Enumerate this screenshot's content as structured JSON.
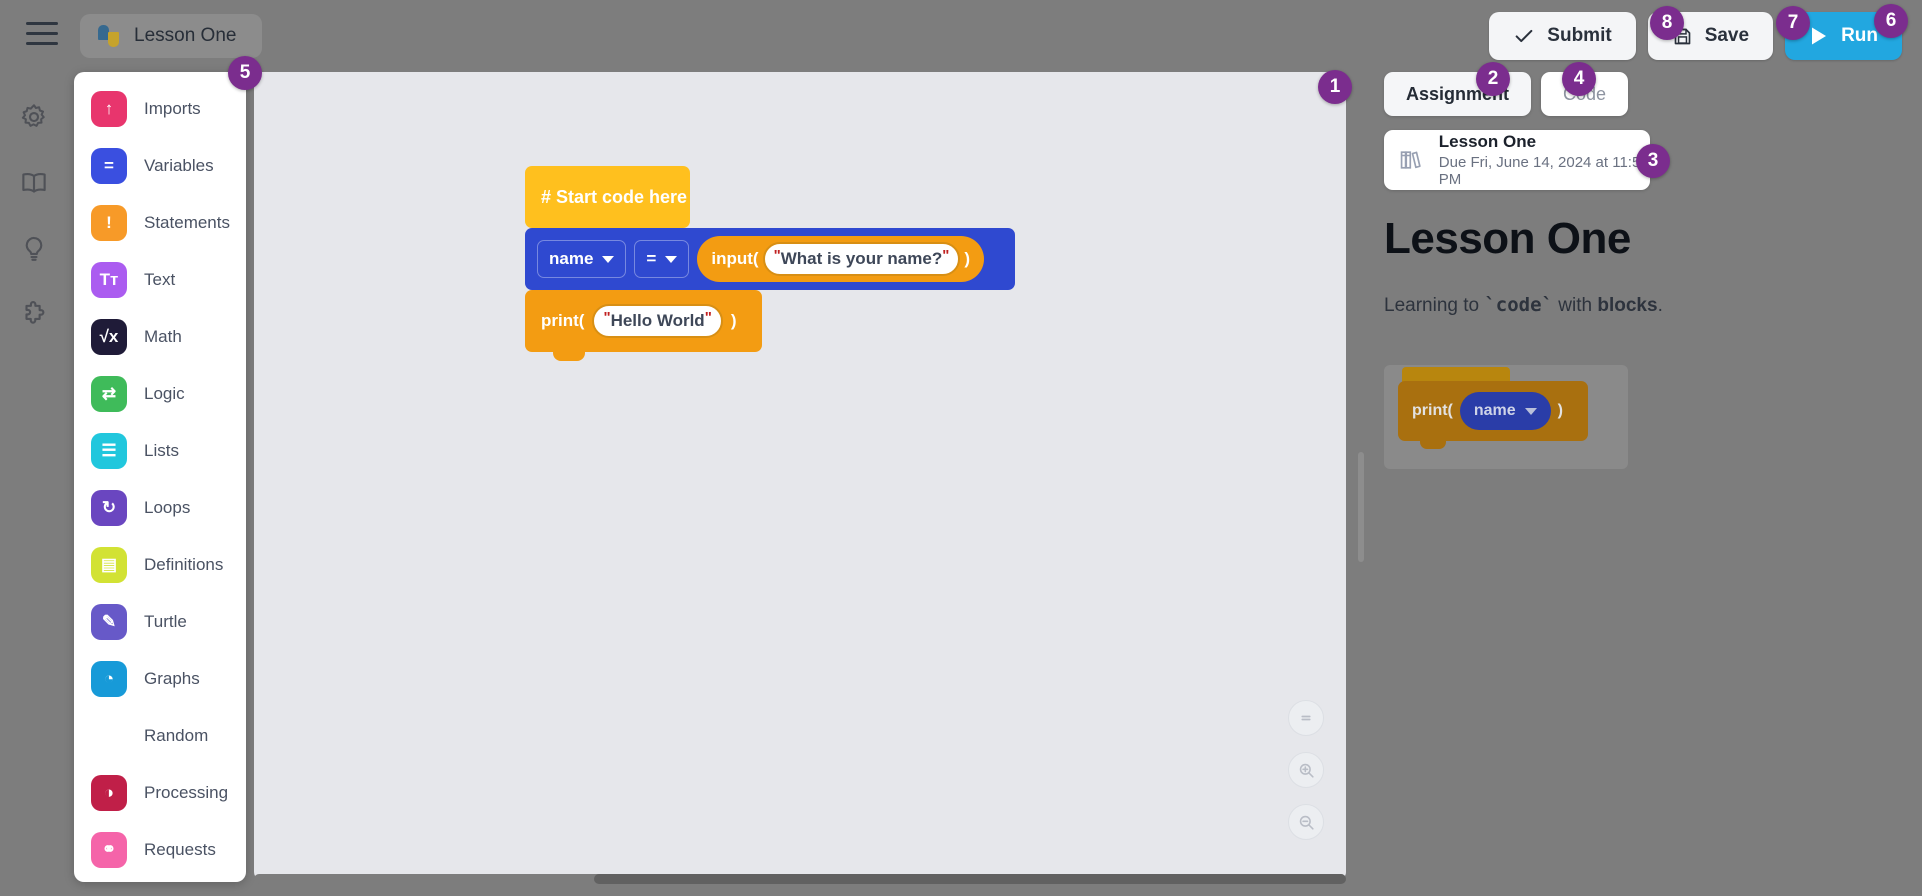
{
  "header": {
    "menu_icon": "hamburger-icon",
    "doc_icon": "python-icon",
    "doc_title": "Lesson One"
  },
  "actions": [
    {
      "id": "submit",
      "label": "Submit",
      "icon": "check-icon",
      "badge": "8"
    },
    {
      "id": "save",
      "label": "Save",
      "icon": "floppy-disk-icon",
      "badge": "7"
    },
    {
      "id": "run",
      "label": "Run",
      "icon": "play-icon",
      "badge": "6"
    }
  ],
  "rail": [
    {
      "id": "settings",
      "icon": "gear-icon"
    },
    {
      "id": "docs",
      "icon": "book-icon"
    },
    {
      "id": "hints",
      "icon": "lightbulb-icon"
    },
    {
      "id": "extensions",
      "icon": "puzzle-icon"
    }
  ],
  "palette": {
    "badge": "5",
    "items": [
      {
        "label": "Imports",
        "icon": "upload-icon",
        "color": "#e8356d",
        "glyph": "↑"
      },
      {
        "label": "Variables",
        "icon": "equals-icon",
        "color": "#3a4fe0",
        "glyph": "="
      },
      {
        "label": "Statements",
        "icon": "exclamation-icon",
        "color": "#f79a28",
        "glyph": "!"
      },
      {
        "label": "Text",
        "icon": "text-icon",
        "color": "#ab5cf0",
        "glyph": "Tᴛ"
      },
      {
        "label": "Math",
        "icon": "sqrt-icon",
        "color": "#1f1b38",
        "glyph": "√x"
      },
      {
        "label": "Logic",
        "icon": "arrows-icon",
        "color": "#3fbb5a",
        "glyph": "⇄"
      },
      {
        "label": "Lists",
        "icon": "list-icon",
        "color": "#21c7dd",
        "glyph": "☰"
      },
      {
        "label": "Loops",
        "icon": "refresh-icon",
        "color": "#6a46c0",
        "glyph": "↻"
      },
      {
        "label": "Definitions",
        "icon": "document-icon",
        "color": "#d2e234",
        "glyph": "▤"
      },
      {
        "label": "Turtle",
        "icon": "pencil-icon",
        "color": "#6759c8",
        "glyph": "✎"
      },
      {
        "label": "Graphs",
        "icon": "pie-chart-icon",
        "color": "#179ad8",
        "glyph": "◔"
      },
      {
        "label": "Random",
        "icon": "shuffle-icon",
        "color": "#7dc council",
        "glyph": "⤨"
      },
      {
        "label": "Processing",
        "icon": "palette-icon",
        "color": "#c01f48",
        "glyph": "◑"
      },
      {
        "label": "Requests",
        "icon": "link-icon",
        "color": "#f564a9",
        "glyph": "⚭"
      }
    ]
  },
  "canvas": {
    "badge": "1",
    "blocks": {
      "comment": "# Start code here",
      "assignment": {
        "variable": "name",
        "operator": "=",
        "call": "input(",
        "string_value": "What is your name?",
        "close_paren": ")"
      },
      "print": {
        "call": "print(",
        "string_value": "Hello World",
        "close_paren": ")"
      }
    },
    "zoom_controls": [
      {
        "id": "reset-zoom",
        "icon": "equals-circle-icon"
      },
      {
        "id": "zoom-in",
        "icon": "magnifier-plus-icon"
      },
      {
        "id": "zoom-out",
        "icon": "magnifier-minus-icon"
      }
    ]
  },
  "right_panel": {
    "tabs": [
      {
        "label": "Assignment",
        "active": true,
        "badge": "2"
      },
      {
        "label": "Code",
        "active": false,
        "badge": "4"
      }
    ],
    "assignment_card": {
      "icon": "books-icon",
      "title": "Lesson One",
      "due": "Due Fri, June 14, 2024 at 11:59 PM",
      "badge": "3"
    },
    "lesson": {
      "heading": "Lesson One",
      "para_1": "Learning to ",
      "para_code": "`code`",
      "para_2": " with ",
      "para_bold": "blocks",
      "para_3": "."
    },
    "preview_block": {
      "call": "print(",
      "variable": "name",
      "close_paren": ")"
    }
  },
  "colors": {
    "accent_run": "#22a7e0",
    "badge": "#7b2d8e",
    "block_comment": "#ffc01e",
    "block_variable": "#2f49d0",
    "block_statement": "#f39c12",
    "canvas_bg": "#e6e7eb",
    "app_bg": "#7d7d7d"
  }
}
